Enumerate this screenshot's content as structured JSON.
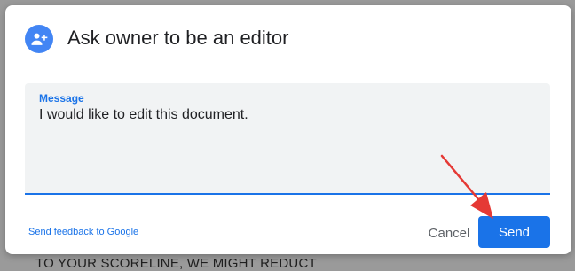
{
  "backdrop": {
    "text": "TO YOUR SCORELINE, WE MIGHT REDUCT"
  },
  "dialog": {
    "icon": "person-add-icon",
    "title": "Ask owner to be an editor",
    "message": {
      "label": "Message",
      "value": "I would like to edit this document."
    },
    "feedback_link": "Send feedback to Google",
    "cancel_label": "Cancel",
    "send_label": "Send"
  },
  "colors": {
    "accent": "#1a73e8",
    "avatar_bg": "#4285f4",
    "annotation_arrow": "#e53935"
  }
}
